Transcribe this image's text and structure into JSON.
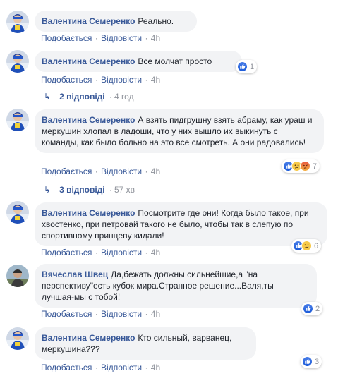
{
  "comments": [
    {
      "author": "Валентина Семеренко",
      "text": "Реально.",
      "like_label": "Подобається",
      "reply_label": "Відповісти",
      "time": "4h",
      "reaction_count": null
    },
    {
      "author": "Валентина Семеренко",
      "text": "Все молчат просто",
      "like_label": "Подобається",
      "reply_label": "Відповісти",
      "time": "4h",
      "reaction_count": "1",
      "replies": {
        "label": "2 відповіді",
        "time": "4 год"
      }
    },
    {
      "author": "Валентина Семеренко",
      "text": "А взять пидгрушну взять абраму, как ураш и меркушин хлопал в ладоши, что у них вышло их выкинуть с команды, как было больно на это все смотреть. А они радовались!",
      "like_label": "Подобається",
      "reply_label": "Відповісти",
      "time": "4h",
      "reaction_count": "7",
      "replies": {
        "label": "3 відповіді",
        "time": "57 хв"
      }
    },
    {
      "author": "Валентина Семеренко",
      "text": "Посмотрите где они! Когда было такое, при хвостенко, при петровай такого не было, чтобы так в слепую по спортивному принцепу кидали!",
      "like_label": "Подобається",
      "reply_label": "Відповісти",
      "time": "4h",
      "reaction_count": "6"
    },
    {
      "author": "Вячеслав Швец",
      "text": "Да,бежать должны сильнейшие,а \"на перспективу\"есть кубок мира.Странное решение...Валя,ты лучшая-мы с тобой!",
      "like_label": "Подобається",
      "reply_label": "Відповісти",
      "time": "4h",
      "reaction_count": "2"
    },
    {
      "author": "Валентина Семеренко",
      "text": "Кто сильный, варванец, меркушина???",
      "like_label": "Подобається",
      "reply_label": "Відповісти",
      "time": "4h",
      "reaction_count": "3"
    }
  ],
  "colors": {
    "link": "#385898",
    "meta": "#90949c",
    "bubble": "#f2f3f5",
    "like": "#1a5ad8"
  }
}
